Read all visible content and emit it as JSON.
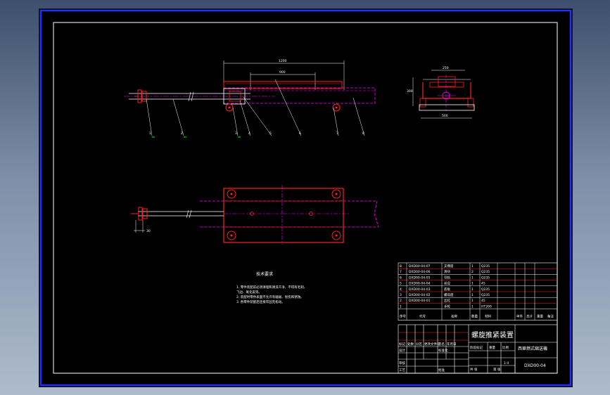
{
  "viewer": {
    "background": "black",
    "sheet_border_color": "#1f2fff"
  },
  "dimensions": {
    "overall_length": "1200",
    "inner_length": "900",
    "side_width": "250",
    "side_height": "300",
    "side_base": "500",
    "plan_small": "30"
  },
  "balloons": [
    "1",
    "2",
    "3",
    "4",
    "5",
    "6",
    "7",
    "8"
  ],
  "notes": {
    "heading": "技术要求",
    "lines": [
      "1. 零件装配前必须清理和清洗干净，不得有毛刺、",
      "   飞边、氧化皮等。",
      "2. 装配时零件表面不允许有磕碰、划伤和锈蚀。",
      "3. 各零件装配后连接牢固无松动。"
    ]
  },
  "bom": {
    "rows": [
      {
        "no": "8",
        "code": "DXD00-04-07",
        "name": "支撑座",
        "qty": "1",
        "material": "Q235"
      },
      {
        "no": "7",
        "code": "DXD00-04-06",
        "name": "滑块",
        "qty": "2",
        "material": "Q235"
      },
      {
        "no": "6",
        "code": "DXD00-04-05",
        "name": "导轨",
        "qty": "1",
        "material": "Q235"
      },
      {
        "no": "5",
        "code": "DXD00-04-04",
        "name": "丝母",
        "qty": "1",
        "material": "45"
      },
      {
        "no": "4",
        "code": "DXD00-04-03",
        "name": "底板",
        "qty": "1",
        "material": "Q235"
      },
      {
        "no": "3",
        "code": "DXD00-04-02",
        "name": "螺母座",
        "qty": "1",
        "material": "Q235"
      },
      {
        "no": "2",
        "code": "DXD00-04-01",
        "name": "丝杠",
        "qty": "1",
        "material": "45"
      },
      {
        "no": "1",
        "code": "",
        "name": "手轮",
        "qty": "1",
        "material": "HT200"
      }
    ],
    "header": {
      "no": "序号",
      "code": "代号",
      "name": "名称",
      "qty": "数量",
      "material": "材料",
      "single": "单件",
      "total": "总计",
      "weight": "重量",
      "remark": "备注"
    }
  },
  "title_block": {
    "drawing_title": "螺旋推紧装置",
    "company": "西華燃式縮送機",
    "drawing_number": "DXD00-04",
    "scale": "1:4",
    "labels": {
      "mark": "标记",
      "count": "处数",
      "zone": "分区",
      "change_no": "更改文件号",
      "sign": "签名",
      "date": "年月日",
      "design": "设计",
      "standardize": "标准化",
      "stage": "阶段标记",
      "weight": "重量",
      "scale": "比例",
      "review": "审核",
      "process": "工艺",
      "approve": "批准",
      "sheets": "共 张",
      "sheet": "第 张"
    }
  }
}
